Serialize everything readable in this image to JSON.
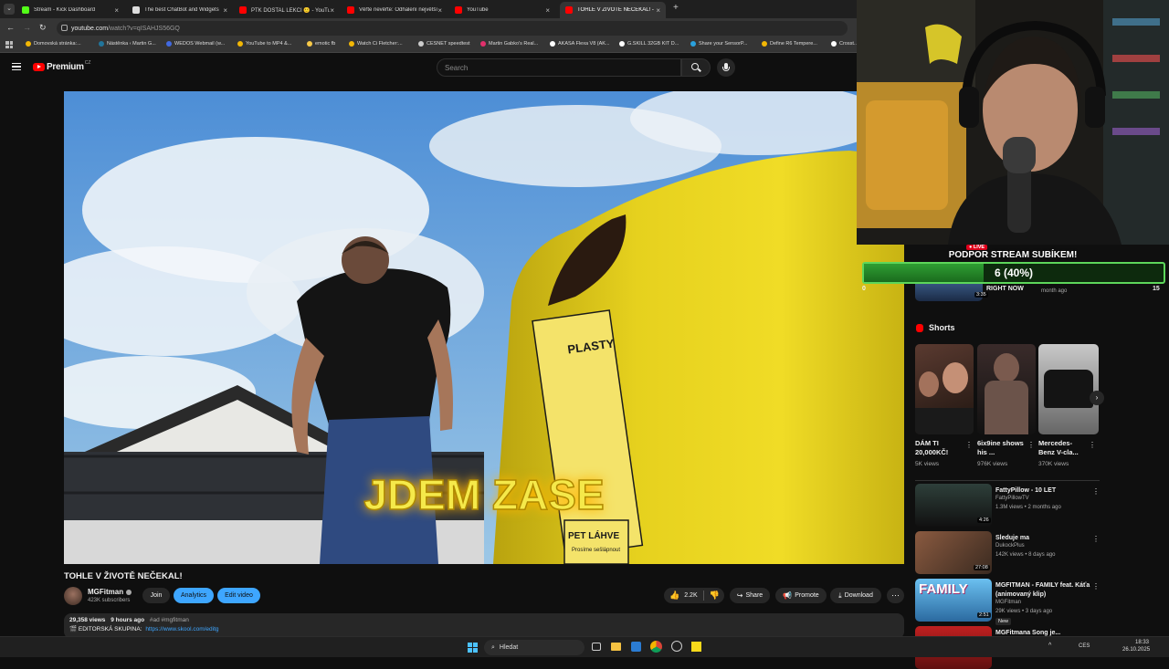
{
  "browser": {
    "tabs": [
      {
        "title": "Stream - Kick Dashboard",
        "color": "#53fc18"
      },
      {
        "title": "The best ChatBot and Widgets",
        "color": "#dddddd"
      },
      {
        "title": "PTK DOSTAL LEKCI 🙂 - YouTube",
        "color": "#ff0000"
      },
      {
        "title": "Věřte nevěřte: Odhalení největší",
        "color": "#ff0000"
      },
      {
        "title": "YouTube",
        "color": "#ff0000"
      },
      {
        "title": "TOHLE V ŽIVOTĚ NEČEKAL! - YouTube",
        "color": "#ff0000"
      }
    ],
    "new_tab": "+",
    "url_host": "youtube.com",
    "url_path": "/watch?v=qISAHJS56GQ",
    "bookmarks": [
      {
        "label": "Domovská stránka:...",
        "color": "#f2b705"
      },
      {
        "label": "Nástěnka ‹ Martin G...",
        "color": "#21759b"
      },
      {
        "label": "WEDOS Webmail (w...",
        "color": "#4169e1"
      },
      {
        "label": "YouTube to MP4 &...",
        "color": "#f2b705"
      },
      {
        "label": "emotic fb",
        "color": "#f7c948"
      },
      {
        "label": "Watch Ci Fletcher:...",
        "color": "#f2b705"
      },
      {
        "label": "CESNET speedtest",
        "color": "#cccccc"
      },
      {
        "label": "Martin Gabko's Real...",
        "color": "#e1306c"
      },
      {
        "label": "AKASA Flexa V8 (AK...",
        "color": "#ffffff"
      },
      {
        "label": "G.SKILL 32GB KIT D...",
        "color": "#ffffff"
      },
      {
        "label": "Share your SensorP...",
        "color": "#2aa1dd"
      },
      {
        "label": "Define R6 Tempere...",
        "color": "#f2b705"
      },
      {
        "label": "Crosst...",
        "color": "#ffffff"
      }
    ]
  },
  "youtube": {
    "logo": "Premium",
    "logo_country": "CZ",
    "search_placeholder": "Search",
    "video_overlay_text": "JDEM ZASE",
    "bin_label_1": "PLASTY",
    "bin_label_2": "PET LÁHVE",
    "bin_label_3": "Prosíme sešlápnout",
    "video_title": "TOHLE V ŽIVOTĚ NEČEKAL!",
    "channel_name": "MGFitman",
    "subscribers": "423K subscribers",
    "join_label": "Join",
    "analytics_label": "Analytics",
    "edit_label": "Edit video",
    "likes": "2.2K",
    "share_label": "Share",
    "promote_label": "Promote",
    "download_label": "Download",
    "views": "29,358 views",
    "posted": "9 hours ago",
    "hashtags": "#ad #mgfitman",
    "desc_line": "🎬 EDITORSKÁ SKUPINA:",
    "desc_link": "https://www.skool.com/editg"
  },
  "sidebar": {
    "top_item_duration": "3:35",
    "top_item_meta": "month ago",
    "shorts_title": "Shorts",
    "shorts": [
      {
        "title": "DÁM TI 20,000KČ!",
        "views": "5K views"
      },
      {
        "title": "6ix9ine shows his ...",
        "views": "976K views"
      },
      {
        "title": "Mercedes-Benz V-cla...",
        "views": "370K views"
      }
    ],
    "videos": [
      {
        "title": "FattyPillow - 10 LET",
        "channel": "FattyPillowTV",
        "meta": "1.3M views • 2 months ago",
        "duration": "4:26",
        "badge": ""
      },
      {
        "title": "Sleduje ma",
        "channel": "DukockPlus",
        "meta": "142K views • 8 days ago",
        "duration": "27:08",
        "badge": ""
      },
      {
        "title": "MGFITMAN - FAMILY feat. Káťa (animovaný klip)",
        "channel": "MGFitman",
        "meta": "29K views • 3 days ago",
        "duration": "2:51",
        "badge": "New"
      },
      {
        "title": "MGFitmana Song je...",
        "channel": "",
        "meta": "",
        "duration": "",
        "badge": ""
      }
    ],
    "family_thumb_text": "FAMILY"
  },
  "stream_overlay": {
    "live_badge": "LIVE",
    "goal_title": "PODPOR STREAM SUBÍKEM!",
    "goal_text": "6 (40%)",
    "goal_percent": 40,
    "goal_min": "0",
    "goal_max": "15",
    "goal_sub": "RIGHT NOW"
  },
  "taskbar": {
    "search_placeholder": "Hledat",
    "lang": "CES",
    "time": "18:33",
    "date": "26.10.2025"
  },
  "colors": {
    "yt_red": "#ff0000",
    "yt_blue": "#3ea6ff",
    "goal_green": "#5dd65a",
    "overlay_yellow": "#f5e94a"
  }
}
